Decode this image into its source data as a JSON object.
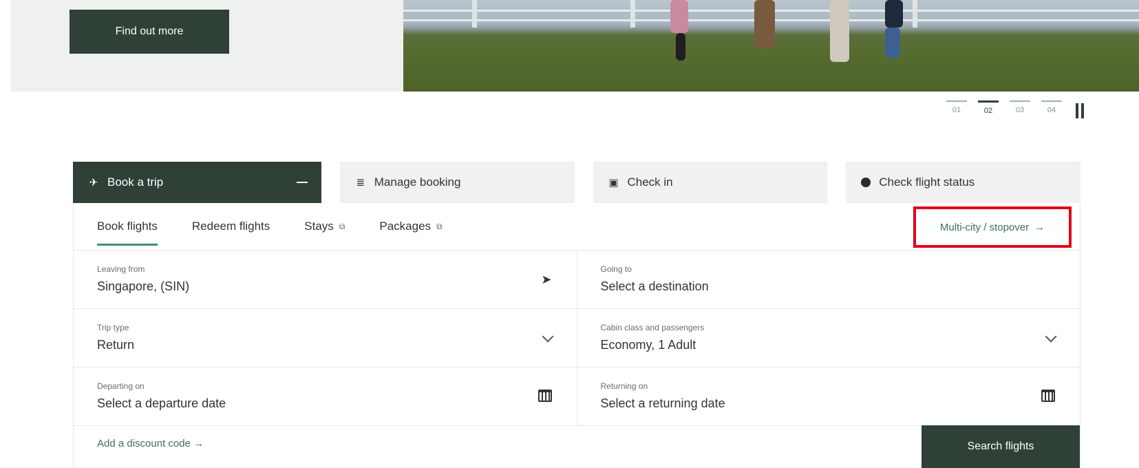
{
  "hero": {
    "cta_label": "Find out more"
  },
  "carousel": {
    "slides": [
      "01",
      "02",
      "03",
      "04"
    ],
    "active_index": 1
  },
  "main_tabs": [
    {
      "label": "Book a trip",
      "icon": "plane-icon",
      "active": true
    },
    {
      "label": "Manage booking",
      "icon": "booking-icon",
      "active": false
    },
    {
      "label": "Check in",
      "icon": "check-in-icon",
      "active": false
    },
    {
      "label": "Check flight status",
      "icon": "status-icon",
      "active": false
    }
  ],
  "sub_tabs": [
    {
      "label": "Book flights",
      "active": true,
      "external": false
    },
    {
      "label": "Redeem flights",
      "active": false,
      "external": false
    },
    {
      "label": "Stays",
      "active": false,
      "external": true
    },
    {
      "label": "Packages",
      "active": false,
      "external": true
    }
  ],
  "multicity": {
    "label": "Multi-city / stopover",
    "arrow": "→"
  },
  "form": {
    "leaving_label": "Leaving from",
    "leaving_value": "Singapore, (SIN)",
    "going_label": "Going to",
    "going_value": "Select a destination",
    "trip_label": "Trip type",
    "trip_value": "Return",
    "cabin_label": "Cabin class and passengers",
    "cabin_value": "Economy, 1 Adult",
    "depart_label": "Departing on",
    "depart_value": "Select a departure date",
    "return_label": "Returning on",
    "return_value": "Select a returning date"
  },
  "discount": {
    "label": "Add a discount code",
    "arrow": "→"
  },
  "search": {
    "label": "Search flights"
  },
  "colors": {
    "brand_dark": "#2f4036",
    "accent_teal": "#3b8f78",
    "highlight_red": "#e0001a"
  }
}
